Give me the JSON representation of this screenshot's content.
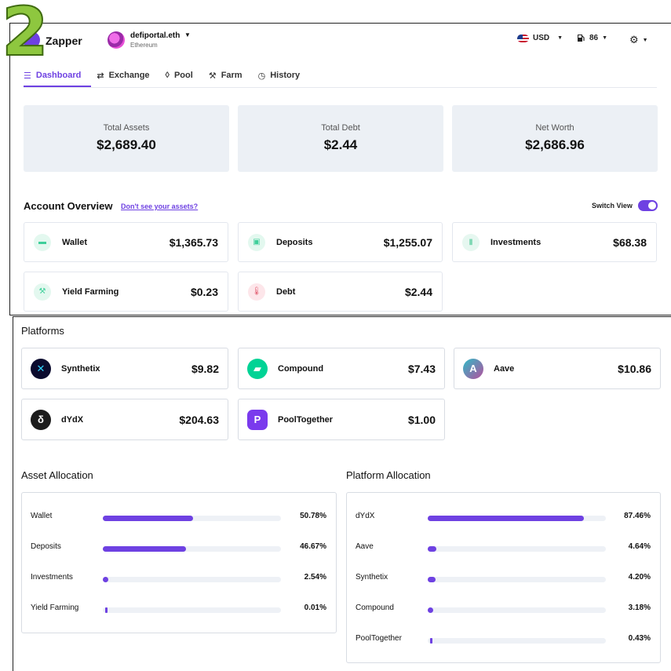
{
  "step_number": "2",
  "header": {
    "brand": "Zapper",
    "account_name": "defiportal.eth",
    "account_network": "Ethereum",
    "currency": "USD",
    "gas": "86"
  },
  "nav": {
    "items": [
      {
        "label": "Dashboard",
        "icon": "layers-icon",
        "active": true
      },
      {
        "label": "Exchange",
        "icon": "swap-arrows-icon",
        "active": false
      },
      {
        "label": "Pool",
        "icon": "droplet-icon",
        "active": false
      },
      {
        "label": "Farm",
        "icon": "tractor-icon",
        "active": false
      },
      {
        "label": "History",
        "icon": "clock-icon",
        "active": false
      }
    ]
  },
  "stats": [
    {
      "label": "Total Assets",
      "value": "$2,689.40"
    },
    {
      "label": "Total Debt",
      "value": "$2.44"
    },
    {
      "label": "Net Worth",
      "value": "$2,686.96"
    }
  ],
  "overview": {
    "title": "Account Overview",
    "link": "Don't see your assets?",
    "switch_label": "Switch View",
    "switch_on": true,
    "cards": [
      {
        "name": "Wallet",
        "value": "$1,365.73",
        "icon": "wallet-icon",
        "color": "#3ecf9a",
        "bg": "#e3f8ef"
      },
      {
        "name": "Deposits",
        "value": "$1,255.07",
        "icon": "deposit-box-icon",
        "color": "#3ecf9a",
        "bg": "#e3f8ef"
      },
      {
        "name": "Investments",
        "value": "$68.38",
        "icon": "bar-chart-icon",
        "color": "#7fd8b4",
        "bg": "#e6f7f0"
      },
      {
        "name": "Yield Farming",
        "value": "$0.23",
        "icon": "tractor-icon",
        "color": "#3ecf9a",
        "bg": "#e3f8ef"
      },
      {
        "name": "Debt",
        "value": "$2.44",
        "icon": "thermometer-icon",
        "color": "#e25a6e",
        "bg": "#fde6ea"
      }
    ]
  },
  "platforms": {
    "title": "Platforms",
    "items": [
      {
        "name": "Synthetix",
        "value": "$9.82",
        "icon": "synthetix-logo-icon",
        "color": "#0b0b2e",
        "glyph": "✕"
      },
      {
        "name": "Compound",
        "value": "$7.43",
        "icon": "compound-logo-icon",
        "color": "#00d395",
        "glyph": "▰"
      },
      {
        "name": "Aave",
        "value": "$10.86",
        "icon": "aave-logo-icon",
        "color": "#b6509e",
        "glyph": "A"
      },
      {
        "name": "dYdX",
        "value": "$204.63",
        "icon": "dydx-logo-icon",
        "color": "#1c1c1c",
        "glyph": "δ"
      },
      {
        "name": "PoolTogether",
        "value": "$1.00",
        "icon": "pooltogether-logo-icon",
        "color": "#7a3aed",
        "glyph": "P"
      }
    ]
  },
  "asset_allocation": {
    "title": "Asset Allocation",
    "rows": [
      {
        "name": "Wallet",
        "pct_label": "50.78%",
        "pct": 50.78
      },
      {
        "name": "Deposits",
        "pct_label": "46.67%",
        "pct": 46.67
      },
      {
        "name": "Investments",
        "pct_label": "2.54%",
        "pct": 2.54
      },
      {
        "name": "Yield Farming",
        "pct_label": "0.01%",
        "pct": 0.01
      }
    ]
  },
  "platform_allocation": {
    "title": "Platform Allocation",
    "rows": [
      {
        "name": "dYdX",
        "pct_label": "87.46%",
        "pct": 87.46
      },
      {
        "name": "Aave",
        "pct_label": "4.64%",
        "pct": 4.64
      },
      {
        "name": "Synthetix",
        "pct_label": "4.20%",
        "pct": 4.2
      },
      {
        "name": "Compound",
        "pct_label": "3.18%",
        "pct": 3.18
      },
      {
        "name": "PoolTogether",
        "pct_label": "0.43%",
        "pct": 0.43
      }
    ]
  },
  "colors": {
    "accent": "#6e41e2",
    "card_bg": "#ecf0f5",
    "step_badge": "#8ec73f"
  }
}
